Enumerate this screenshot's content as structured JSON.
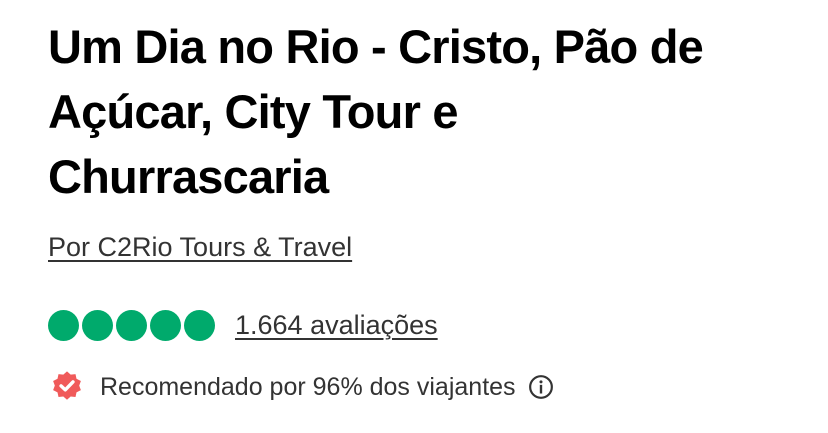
{
  "title": {
    "lines": [
      "Um Dia no Rio - Cristo, Pão de",
      "Açúcar, City Tour e",
      "Churrascaria"
    ]
  },
  "operator": "Por C2Rio Tours & Travel",
  "rating": {
    "value": 5,
    "max": 5,
    "reviews_label": "1.664 avaliações",
    "color": "#00aa6c"
  },
  "recommendation": {
    "text": "Recomendado por 96% dos viajantes",
    "badge_icon": "check-badge-icon",
    "badge_color": "#f05a5a",
    "info_icon": "info-icon"
  }
}
